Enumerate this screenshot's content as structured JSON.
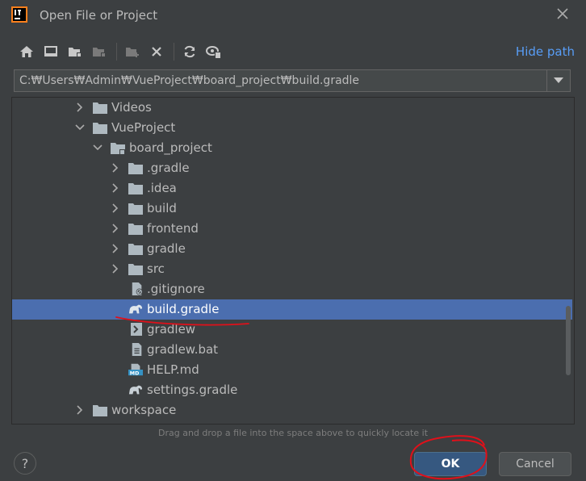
{
  "window": {
    "title": "Open File or Project"
  },
  "toolbar": {
    "hide_path": "Hide path"
  },
  "path": {
    "value": "C:₩Users₩Admin₩VueProject₩board_project₩build.gradle"
  },
  "tree": {
    "items": [
      {
        "label": "Videos",
        "type": "folder",
        "expanded": false
      },
      {
        "label": "VueProject",
        "type": "folder",
        "expanded": true
      },
      {
        "label": "board_project",
        "type": "project",
        "expanded": true
      },
      {
        "label": ".gradle",
        "type": "folder",
        "expanded": false
      },
      {
        "label": ".idea",
        "type": "folder",
        "expanded": false
      },
      {
        "label": "build",
        "type": "folder",
        "expanded": false
      },
      {
        "label": "frontend",
        "type": "folder",
        "expanded": false
      },
      {
        "label": "gradle",
        "type": "folder",
        "expanded": false
      },
      {
        "label": "src",
        "type": "folder",
        "expanded": false
      },
      {
        "label": ".gitignore",
        "type": "gitignore"
      },
      {
        "label": "build.gradle",
        "type": "gradle",
        "selected": true
      },
      {
        "label": "gradlew",
        "type": "script"
      },
      {
        "label": "gradlew.bat",
        "type": "file"
      },
      {
        "label": "HELP.md",
        "type": "markdown"
      },
      {
        "label": "settings.gradle",
        "type": "gradle"
      },
      {
        "label": "workspace",
        "type": "folder",
        "expanded": false
      }
    ]
  },
  "hint": "Drag and drop a file into the space above to quickly locate it",
  "buttons": {
    "help": "?",
    "ok": "OK",
    "cancel": "Cancel"
  },
  "colors": {
    "accent": "#4b6eaf",
    "link": "#589df6",
    "annotation": "#e0101a"
  }
}
